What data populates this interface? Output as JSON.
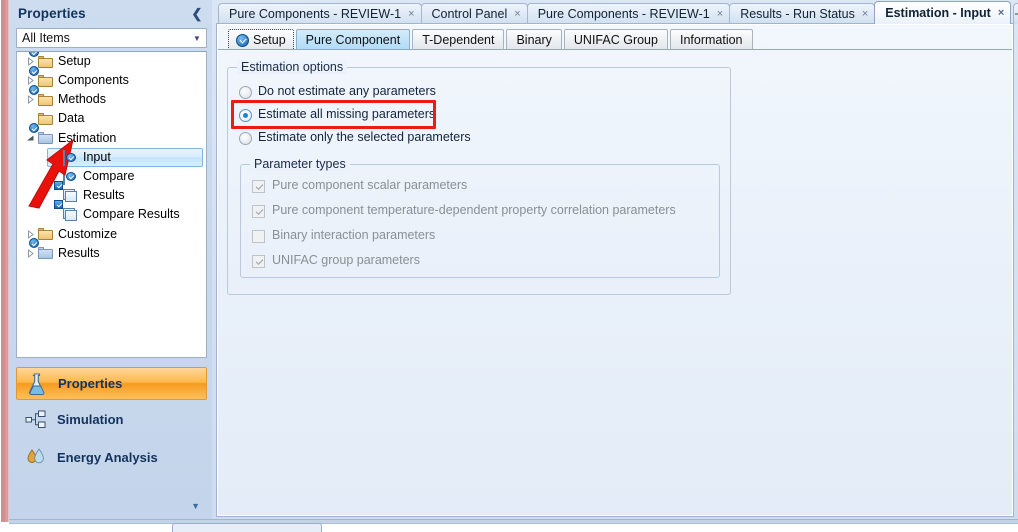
{
  "window": {
    "left_panel_title": "Properties",
    "collapse_icon": "chevron-left-icon"
  },
  "filter_combo": {
    "value": "All Items",
    "arrow_icon": "chevron-down-icon"
  },
  "tree": {
    "items": [
      {
        "label": "Setup",
        "indent": 0,
        "icon": "folder-check-icon",
        "twisty": "collapsed",
        "selected": false
      },
      {
        "label": "Components",
        "indent": 0,
        "icon": "folder-check-icon",
        "twisty": "collapsed",
        "selected": false
      },
      {
        "label": "Methods",
        "indent": 0,
        "icon": "folder-check-icon",
        "twisty": "collapsed",
        "selected": false
      },
      {
        "label": "Data",
        "indent": 0,
        "icon": "folder-icon",
        "twisty": "none",
        "selected": false
      },
      {
        "label": "Estimation",
        "indent": 0,
        "icon": "folder-open-check-icon",
        "twisty": "expanded",
        "selected": false
      },
      {
        "label": "Input",
        "indent": 1,
        "icon": "page-check-icon",
        "twisty": "none",
        "selected": true
      },
      {
        "label": "Compare",
        "indent": 1,
        "icon": "page-check-icon",
        "twisty": "none",
        "selected": false
      },
      {
        "label": "Results",
        "indent": 1,
        "icon": "results-icon",
        "twisty": "none",
        "selected": false
      },
      {
        "label": "Compare Results",
        "indent": 1,
        "icon": "results-icon",
        "twisty": "none",
        "selected": false
      },
      {
        "label": "Customize",
        "indent": 0,
        "icon": "folder-icon",
        "twisty": "collapsed",
        "selected": false
      },
      {
        "label": "Results",
        "indent": 0,
        "icon": "folder-open-check-icon",
        "twisty": "collapsed",
        "selected": false
      }
    ]
  },
  "nav": {
    "items": [
      {
        "label": "Properties",
        "icon": "flask-icon",
        "active": true
      },
      {
        "label": "Simulation",
        "icon": "flowsheet-icon",
        "active": false
      },
      {
        "label": "Energy Analysis",
        "icon": "energy-icon",
        "active": false
      }
    ],
    "more_icon": "chevron-down-icon"
  },
  "document_tabs": {
    "items": [
      {
        "label": "Pure Components - REVIEW-1",
        "active": false,
        "closable": true
      },
      {
        "label": "Control Panel",
        "active": false,
        "closable": true
      },
      {
        "label": "Pure Components - REVIEW-1",
        "active": false,
        "closable": true
      },
      {
        "label": "Results - Run Status",
        "active": false,
        "closable": true
      },
      {
        "label": "Estimation - Input",
        "active": true,
        "closable": true
      }
    ],
    "new_tab_label": "+",
    "close_glyph": "×"
  },
  "sub_tabs": {
    "items": [
      {
        "label": "Setup",
        "selected": false,
        "focused": true,
        "has_check_icon": true
      },
      {
        "label": "Pure Component",
        "selected": true,
        "focused": false,
        "has_check_icon": false
      },
      {
        "label": "T-Dependent",
        "selected": false,
        "focused": false,
        "has_check_icon": false
      },
      {
        "label": "Binary",
        "selected": false,
        "focused": false,
        "has_check_icon": false
      },
      {
        "label": "UNIFAC Group",
        "selected": false,
        "focused": false,
        "has_check_icon": false
      },
      {
        "label": "Information",
        "selected": false,
        "focused": false,
        "has_check_icon": false
      }
    ]
  },
  "estimation_options": {
    "legend": "Estimation options",
    "radios": [
      {
        "label": "Do not estimate any parameters",
        "checked": false,
        "highlighted": false
      },
      {
        "label": "Estimate all missing parameters",
        "checked": true,
        "highlighted": true
      },
      {
        "label": "Estimate only the selected parameters",
        "checked": false,
        "highlighted": false
      }
    ]
  },
  "parameter_types": {
    "legend": "Parameter types",
    "checkboxes": [
      {
        "label": "Pure component scalar parameters",
        "checked": true,
        "enabled": false
      },
      {
        "label": "Pure component temperature-dependent property correlation parameters",
        "checked": true,
        "enabled": false
      },
      {
        "label": "Binary interaction parameters",
        "checked": false,
        "enabled": false
      },
      {
        "label": "UNIFAC group parameters",
        "checked": true,
        "enabled": false
      }
    ]
  },
  "annotations": {
    "arrow_color": "#e8110b",
    "highlight_color": "#ee1b15",
    "arrow_points_to": "Input"
  }
}
